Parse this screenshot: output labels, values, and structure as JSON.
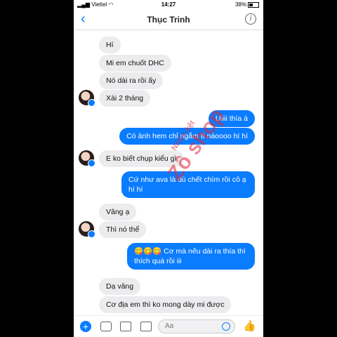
{
  "status_bar": {
    "carrier": "Viettel",
    "time": "14:27",
    "battery": "38%"
  },
  "header": {
    "contact_name": "Thục Trinh",
    "back_icon": "chevron-left-icon",
    "info_icon": "info-icon"
  },
  "messages": [
    {
      "dir": "in",
      "text": "Hí"
    },
    {
      "dir": "in",
      "text": "Mi em chuốt DHC"
    },
    {
      "dir": "in",
      "text": "Nó dài ra rồi ấy"
    },
    {
      "dir": "in",
      "text": "Xài 2 tháng"
    },
    {
      "dir": "out",
      "text": "Uiiii thía á"
    },
    {
      "dir": "out",
      "text": "Có ảnh hem chỉ ngắm tí nàoooo hí hí"
    },
    {
      "dir": "in",
      "text": "E ko biết chụp kiểu gì"
    },
    {
      "dir": "out",
      "text": "Cứ như ava là dù chết chìm rồi cô ạ hí hí"
    },
    {
      "dir": "in",
      "text": "Vâng ạ"
    },
    {
      "dir": "in",
      "text": "Thì nó thể"
    },
    {
      "dir": "out",
      "text": "😋😋😋 Cơ mà nếu dài ra thía thì thích quá rồi iii"
    },
    {
      "dir": "in",
      "text": "Dạ vâng"
    },
    {
      "dir": "in",
      "text": "Cơ địa em thì ko mong dày mi được"
    }
  ],
  "watermark": {
    "line1": "Nhâm kệt",
    "line2": "Zô shop"
  },
  "composer": {
    "placeholder": "Aa"
  }
}
